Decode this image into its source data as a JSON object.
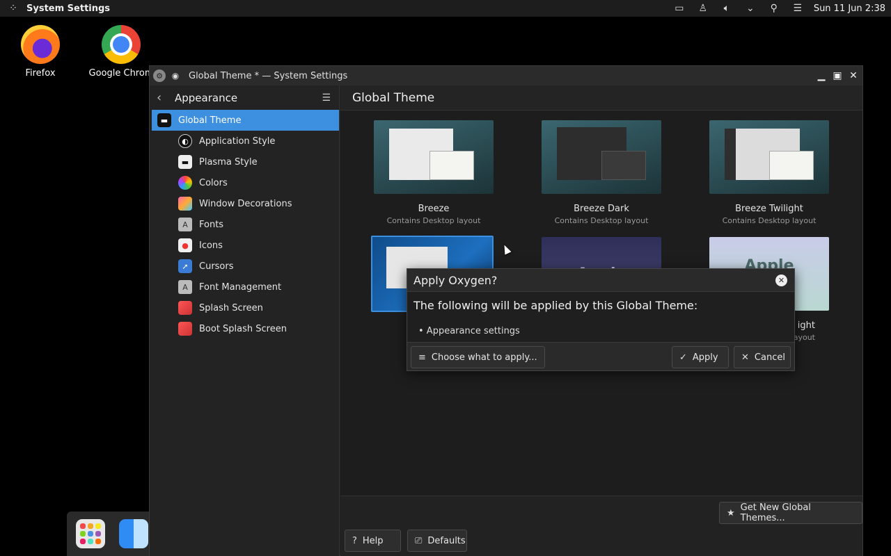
{
  "topbar": {
    "app_name": "System Settings",
    "clock": "Sun 11 Jun 2:38"
  },
  "desktop": {
    "icons": [
      {
        "label": "Firefox"
      },
      {
        "label": "Google Chrom"
      }
    ]
  },
  "window": {
    "title": "Global Theme * — System Settings",
    "sidebar": {
      "header": "Appearance",
      "items": [
        {
          "label": "Global Theme",
          "icon": "global-theme-icon"
        },
        {
          "label": "Application Style",
          "icon": "application-style-icon"
        },
        {
          "label": "Plasma Style",
          "icon": "plasma-style-icon"
        },
        {
          "label": "Colors",
          "icon": "colors-icon"
        },
        {
          "label": "Window Decorations",
          "icon": "window-decorations-icon"
        },
        {
          "label": "Fonts",
          "icon": "fonts-icon"
        },
        {
          "label": "Icons",
          "icon": "icons-icon"
        },
        {
          "label": "Cursors",
          "icon": "cursors-icon"
        },
        {
          "label": "Font Management",
          "icon": "font-management-icon"
        },
        {
          "label": "Splash Screen",
          "icon": "splash-screen-icon"
        },
        {
          "label": "Boot Splash Screen",
          "icon": "boot-splash-screen-icon"
        }
      ]
    },
    "content": {
      "heading": "Global Theme",
      "themes": [
        {
          "name": "Breeze",
          "subtitle": "Contains Desktop layout"
        },
        {
          "name": "Breeze Dark",
          "subtitle": "Contains Desktop layout"
        },
        {
          "name": "Breeze Twilight",
          "subtitle": "Contains Desktop layout"
        },
        {
          "name": "",
          "subtitle": ""
        },
        {
          "name": "",
          "subtitle": "",
          "thumb_text": "Apple"
        },
        {
          "name": "ight",
          "subtitle": "ayout",
          "thumb_text": "Apple\nna"
        }
      ]
    },
    "buttons": {
      "get_new": "Get New Global Themes...",
      "help": "Help",
      "defaults": "Defaults"
    }
  },
  "dialog": {
    "title": "Apply Oxygen?",
    "message": "The following will be applied by this Global Theme:",
    "bullet": "• Appearance settings",
    "choose": "Choose what to apply...",
    "apply": "Apply",
    "cancel": "Cancel"
  }
}
